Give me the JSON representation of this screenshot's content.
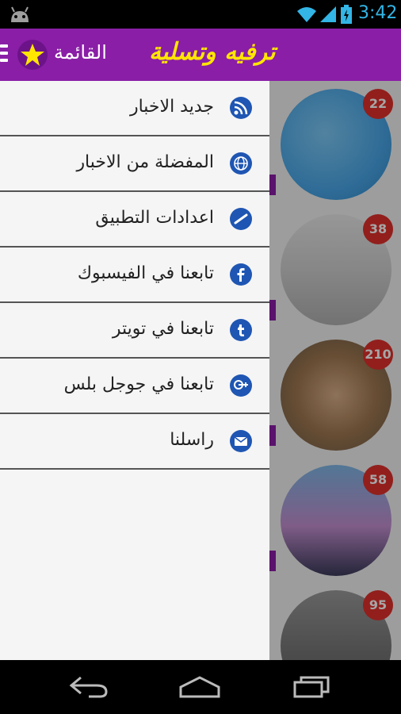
{
  "status": {
    "time": "3:42",
    "icons": [
      "android-icon",
      "wifi-icon",
      "signal-icon",
      "battery-icon"
    ]
  },
  "appbar": {
    "title": "ترفيه وتسلية",
    "menu_label": "القائمة",
    "colors": {
      "bar": "#8a1ea6",
      "title": "#ffe600"
    }
  },
  "drawer": {
    "items": [
      {
        "label": "جديد الاخبار",
        "icon": "rss-icon"
      },
      {
        "label": "المفضلة من الاخبار",
        "icon": "globe-icon"
      },
      {
        "label": "اعدادات التطبيق",
        "icon": "settings-icon"
      },
      {
        "label": "تابعنا في الفيسبوك",
        "icon": "facebook-icon"
      },
      {
        "label": "تابعنا في تويتر",
        "icon": "tumblr-icon"
      },
      {
        "label": "تابعنا في جوجل بلس",
        "icon": "google-plus-icon"
      },
      {
        "label": "راسلنا",
        "icon": "mail-icon"
      }
    ]
  },
  "news": [
    {
      "count": "22"
    },
    {
      "count": "38"
    },
    {
      "count": "210"
    },
    {
      "count": "58"
    },
    {
      "count": "95"
    }
  ],
  "navbar": {
    "icons": [
      "back-icon",
      "home-icon",
      "recents-icon"
    ]
  },
  "colors": {
    "badge": "#e0302c",
    "drawer_icon": "#1f56b3"
  }
}
